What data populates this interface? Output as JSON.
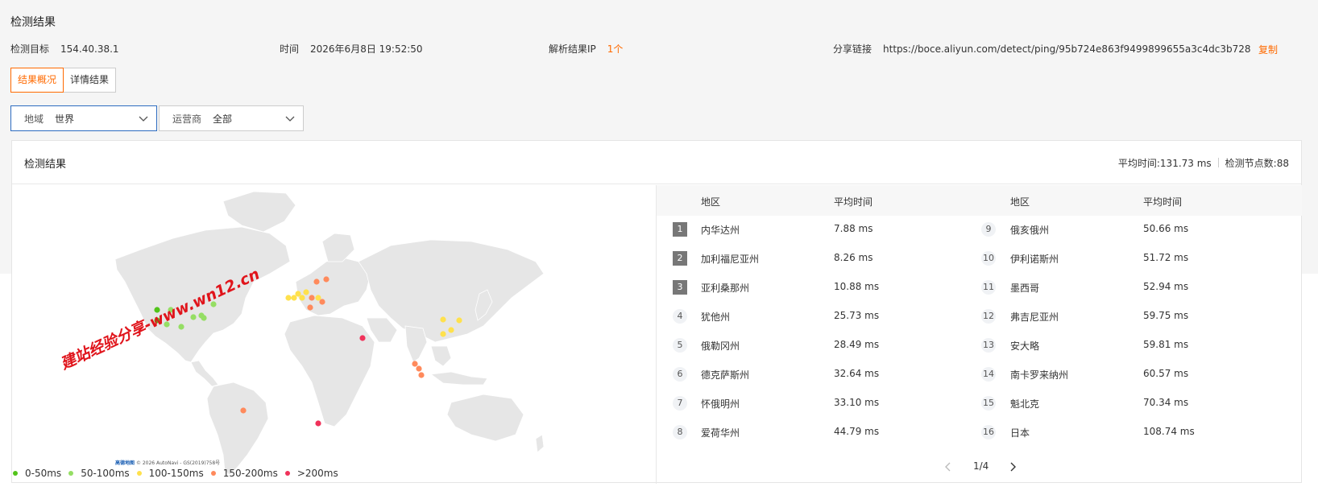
{
  "header": {
    "title": "检测结果",
    "target_label": "检测目标",
    "target_value": "154.40.38.1",
    "time_label": "时间",
    "time_value": "2026年6月8日 19:52:50",
    "ip_label": "解析结果IP",
    "ip_value": "1个",
    "share_label": "分享链接",
    "share_value": "https://boce.aliyun.com/detect/ping/95b724e863f9499899655a3c4dc3b728",
    "copy_label": "复制"
  },
  "tabs": [
    {
      "label": "结果概况",
      "active": true
    },
    {
      "label": "详情结果",
      "active": false
    }
  ],
  "filters": {
    "region": {
      "label": "地域",
      "value": "世界"
    },
    "carrier": {
      "label": "运营商",
      "value": "全部"
    }
  },
  "panel": {
    "title": "检测结果",
    "avg_time": "平均时间:131.73 ms",
    "node_count": "检测节点数:88"
  },
  "table": {
    "headers": [
      "地区",
      "平均时间",
      "地区",
      "平均时间"
    ],
    "left_rows": [
      {
        "rank": "1",
        "region": "内华达州",
        "time": "7.88 ms"
      },
      {
        "rank": "2",
        "region": "加利福尼亚州",
        "time": "8.26 ms"
      },
      {
        "rank": "3",
        "region": "亚利桑那州",
        "time": "10.88 ms"
      },
      {
        "rank": "4",
        "region": "犹他州",
        "time": "25.73 ms"
      },
      {
        "rank": "5",
        "region": "俄勒冈州",
        "time": "28.49 ms"
      },
      {
        "rank": "6",
        "region": "德克萨斯州",
        "time": "32.64 ms"
      },
      {
        "rank": "7",
        "region": "怀俄明州",
        "time": "33.10 ms"
      },
      {
        "rank": "8",
        "region": "爱荷华州",
        "time": "44.79 ms"
      }
    ],
    "right_rows": [
      {
        "rank": "9",
        "region": "俄亥俄州",
        "time": "50.66 ms"
      },
      {
        "rank": "10",
        "region": "伊利诺斯州",
        "time": "51.72 ms"
      },
      {
        "rank": "11",
        "region": "墨西哥",
        "time": "52.94 ms"
      },
      {
        "rank": "12",
        "region": "弗吉尼亚州",
        "time": "59.75 ms"
      },
      {
        "rank": "13",
        "region": "安大略",
        "time": "59.81 ms"
      },
      {
        "rank": "14",
        "region": "南卡罗来纳州",
        "time": "60.57 ms"
      },
      {
        "rank": "15",
        "region": "魁北克",
        "time": "70.34 ms"
      },
      {
        "rank": "16",
        "region": "日本",
        "time": "108.74 ms"
      }
    ]
  },
  "pager": {
    "text": "1/4"
  },
  "legend": [
    {
      "label": "0-50ms",
      "color": "#52c41a"
    },
    {
      "label": "50-100ms",
      "color": "#95de64"
    },
    {
      "label": "100-150ms",
      "color": "#ffe14d"
    },
    {
      "label": "150-200ms",
      "color": "#ff8a5c"
    },
    {
      "label": ">200ms",
      "color": "#f0325a"
    }
  ],
  "map": {
    "credit_brand": "高德地图",
    "credit_text": "© 2026 AutoNavi - GS(2019)758号"
  },
  "watermark": "建站经验分享-www.wn12.cn"
}
